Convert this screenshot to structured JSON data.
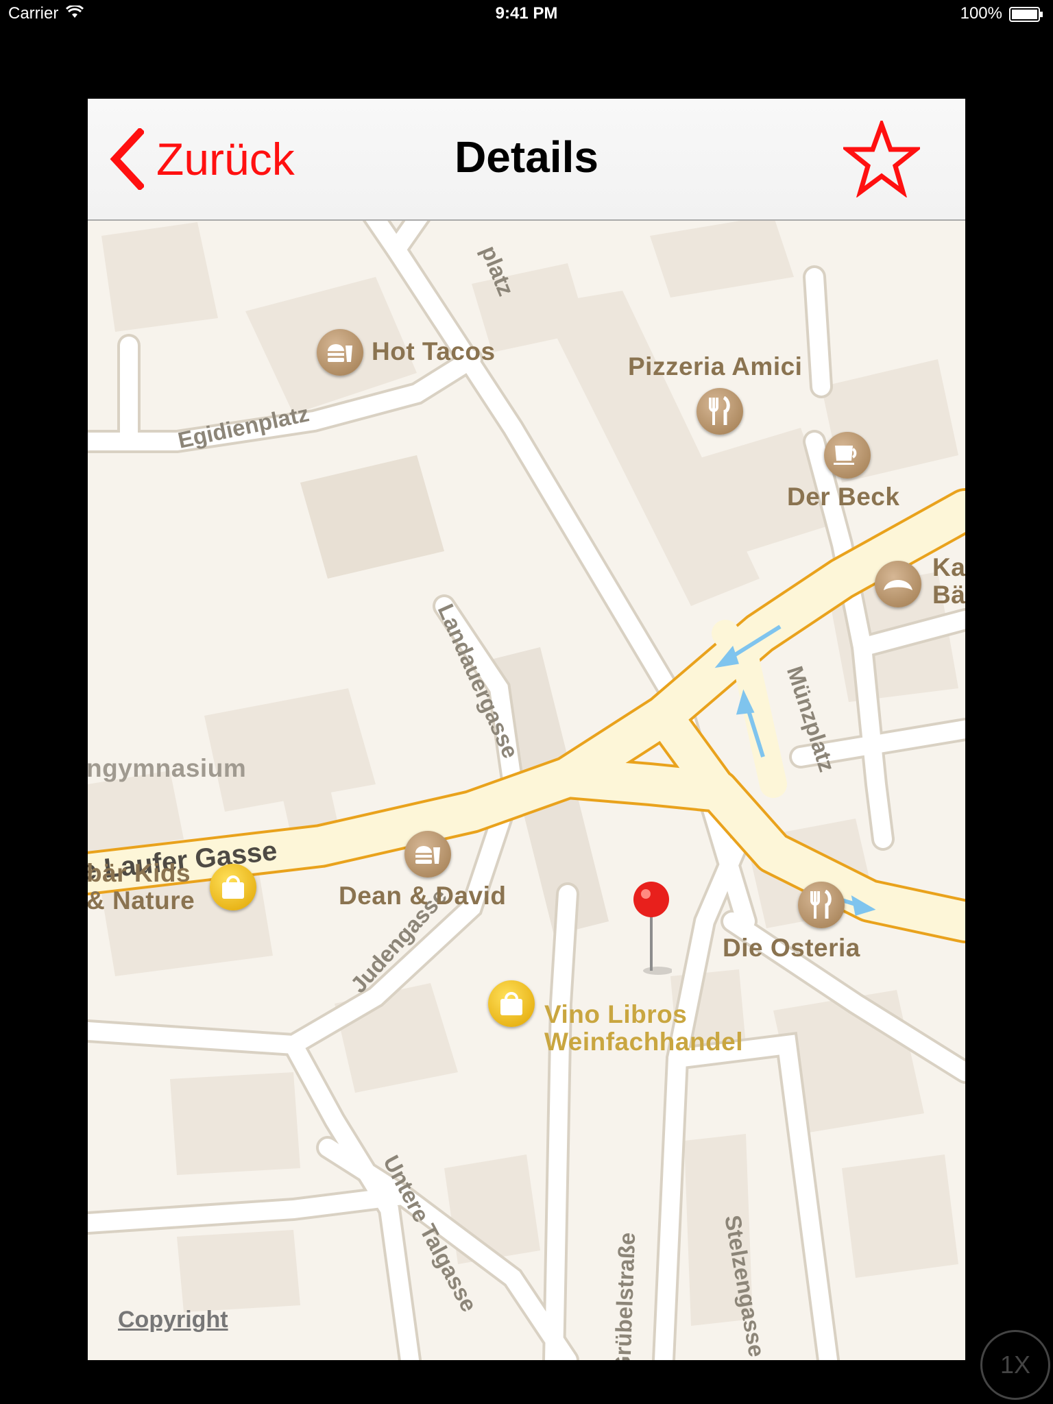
{
  "status_bar": {
    "carrier": "Carrier",
    "time": "9:41 PM",
    "battery": "100%"
  },
  "nav": {
    "back_label": "Zurück",
    "title": "Details",
    "favorite_icon": "star-outline-icon",
    "accent_color": "#ff1010"
  },
  "map": {
    "places": {
      "hot_tacos": "Hot Tacos",
      "pizzeria_amici": "Pizzeria Amici",
      "der_beck": "Der Beck",
      "bakery_partial_1": "Ka",
      "bakery_partial_2": "Bä",
      "gymnasium": "ngymnasium",
      "kids_nature_1": "bär Kids",
      "kids_nature_2": "& Nature",
      "dean_david": "Dean & David",
      "die_osteria": "Die Osteria",
      "vino_1": "Vino Libros",
      "vino_2": "Weinfachhandel"
    },
    "streets": {
      "egidienplatz": "Egidienplatz",
      "landauergasse": "Landauergasse",
      "muenzplatz": "Münzplatz",
      "laufer_gasse": "e Laufer Gasse",
      "judengasse": "Judengasse",
      "untere_talgasse": "Untere Talgasse",
      "gruebelstrasse": "Grübelstraße",
      "stelzengasse": "Stelzengasse",
      "platz_top": "platz"
    },
    "copyright": "Copyright"
  },
  "zoom_badge": "1X"
}
